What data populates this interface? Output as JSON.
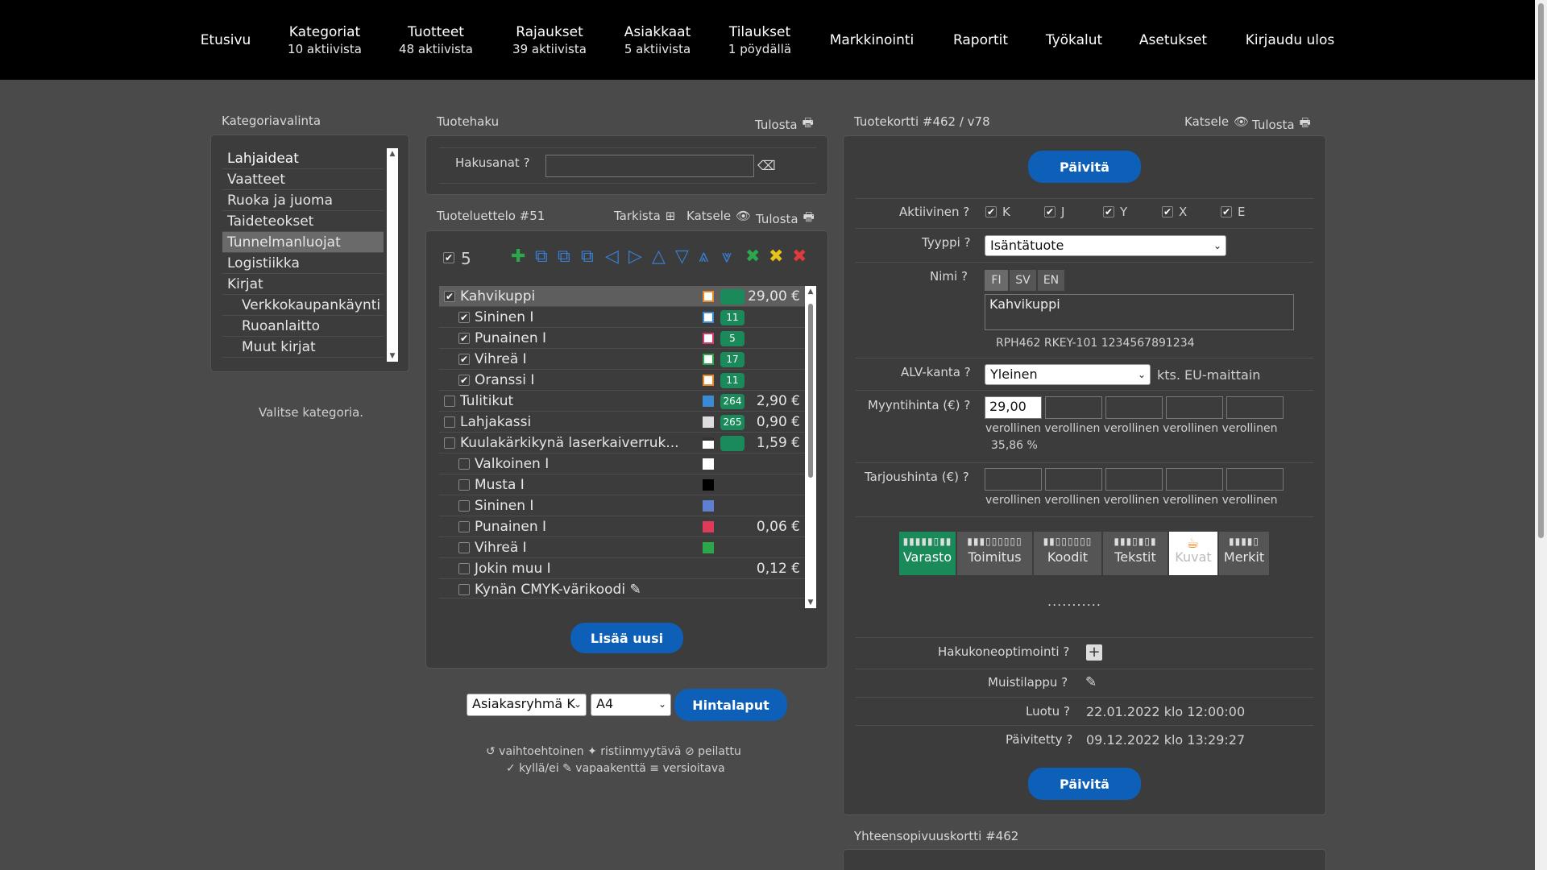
{
  "nav": [
    {
      "label": "Etusivu",
      "sub": ""
    },
    {
      "label": "Kategoriat",
      "sub": "10 aktiivista"
    },
    {
      "label": "Tuotteet",
      "sub": "48 aktiivista"
    },
    {
      "label": "Rajaukset",
      "sub": "39 aktiivista"
    },
    {
      "label": "Asiakkaat",
      "sub": "5 aktiivista"
    },
    {
      "label": "Tilaukset",
      "sub": "1 pöydällä"
    },
    {
      "label": "Markkinointi",
      "sub": ""
    },
    {
      "label": "Raportit",
      "sub": ""
    },
    {
      "label": "Työkalut",
      "sub": ""
    },
    {
      "label": "Asetukset",
      "sub": ""
    },
    {
      "label": "Kirjaudu ulos",
      "sub": ""
    }
  ],
  "category": {
    "title": "Kategoriavalinta",
    "items": [
      "Lahjaideat",
      "Vaatteet",
      "Ruoka ja juoma",
      "Taideteokset",
      "Tunnelmanluojat",
      "Logistiikka",
      "Kirjat",
      "Verkkokaupankäynti",
      "Ruoanlaitto",
      "Muut kirjat"
    ],
    "hint": "Valitse kategoria."
  },
  "search": {
    "title": "Tuotehaku",
    "print": "Tulosta",
    "label": "Hakusanat",
    "value": ""
  },
  "productlist": {
    "title": "Tuoteluettelo #51",
    "check": "Tarkista",
    "view": "Katsele",
    "print": "Tulosta",
    "selected_count": "5",
    "rows": [
      {
        "name": "Kahvikuppi",
        "checked": "✔",
        "price": "29,00 €",
        "badge": ""
      },
      {
        "name": "Sininen I",
        "checked": "✔",
        "price": "",
        "badge": "11"
      },
      {
        "name": "Punainen I",
        "checked": "✔",
        "price": "",
        "badge": "5"
      },
      {
        "name": "Vihreä I",
        "checked": "✔",
        "price": "",
        "badge": "17"
      },
      {
        "name": "Oranssi I",
        "checked": "✔",
        "price": "",
        "badge": "11"
      },
      {
        "name": "Tulitikut",
        "checked": "",
        "price": "2,90 €",
        "badge": "264"
      },
      {
        "name": "Lahjakassi",
        "checked": "",
        "price": "0,90 €",
        "badge": "265"
      },
      {
        "name": "Kuulakärkikynä laserkaiverruk...",
        "checked": "",
        "price": "1,59 €",
        "badge": ""
      },
      {
        "name": "Valkoinen I",
        "checked": "",
        "price": "",
        "badge": ""
      },
      {
        "name": "Musta I",
        "checked": "",
        "price": "",
        "badge": ""
      },
      {
        "name": "Sininen I",
        "checked": "",
        "price": "",
        "badge": ""
      },
      {
        "name": "Punainen I",
        "checked": "",
        "price": "0,06 €",
        "badge": ""
      },
      {
        "name": "Vihreä I",
        "checked": "",
        "price": "",
        "badge": ""
      },
      {
        "name": "Jokin muu I",
        "checked": "",
        "price": "0,12 €",
        "badge": ""
      },
      {
        "name": "Kynän CMYK-värikoodi ✎",
        "checked": "",
        "price": "",
        "badge": ""
      }
    ],
    "add_new": "Lisää uusi"
  },
  "pricetags": {
    "group": "Asiakasryhmä K",
    "size": "A4",
    "button": "Hintalaput"
  },
  "legend": {
    "line1": "↺ vaihtoehtoinen  ✦ ristiinmyytävä  ⊘ peilattu",
    "line2": "✓ kyllä/ei  ✎ vapaakenttä  ≡ versioitava"
  },
  "card": {
    "title": "Tuotekortti #462 / v78",
    "view": "Katsele",
    "print": "Tulosta",
    "update": "Päivitä",
    "active_label": "Aktiivinen",
    "active_flags": [
      "K",
      "J",
      "Y",
      "X",
      "E"
    ],
    "type_label": "Tyyppi",
    "type_value": "Isäntätuote",
    "name_label": "Nimi",
    "langs": [
      "FI",
      "SV",
      "EN"
    ],
    "name_value": "Kahvikuppi",
    "codes": "RPH462   RKEY-101   1234567891234",
    "vat_label": "ALV-kanta",
    "vat_value": "Yleinen",
    "vat_note": "kts. EU-maittain",
    "sale_label": "Myyntihinta (€)",
    "sale_value": "29,00",
    "sale_notes": "verollinen verollinen verollinen verollinen verollinen",
    "sale_margin": "35,86 %",
    "offer_label": "Tarjoushinta (€)",
    "offer_notes": "verollinen verollinen verollinen verollinen verollinen",
    "tabs": [
      "Varasto",
      "Toimitus",
      "Koodit",
      "Tekstit",
      "Kuvat",
      "Merkit"
    ],
    "dots": "...........",
    "seo_label": "Hakukoneoptimointi",
    "memo_label": "Muistilappu",
    "created_label": "Luotu",
    "created_value": "22.01.2022 klo 12:00:00",
    "updated_label": "Päivitetty",
    "updated_value": "09.12.2022 klo 13:29:27"
  },
  "compat": {
    "title": "Yhteensopivuuskortti #462"
  }
}
